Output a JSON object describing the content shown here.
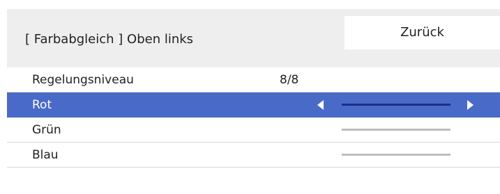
{
  "header": {
    "title": "[ Farbabgleich ] Oben links",
    "back_label": "Zurück"
  },
  "rows": [
    {
      "label": "Regelungsniveau",
      "value": "8/8"
    },
    {
      "label": "Rot",
      "selected": true,
      "icons": [
        "arrow-left-icon",
        "arrow-right-icon"
      ]
    },
    {
      "label": "Grün"
    },
    {
      "label": "Blau"
    }
  ],
  "colors": {
    "background": "#eeeeee",
    "panel": "#ffffff",
    "highlight": "#4a6ac8",
    "slider_active": "#1b2f86",
    "slider_inactive": "#bdbdbd"
  }
}
